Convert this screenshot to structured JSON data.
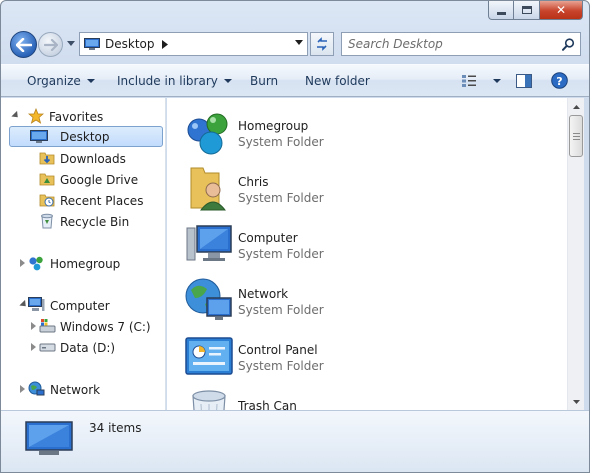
{
  "window": {
    "caption": {
      "minimize": "minimize",
      "maximize": "maximize",
      "close_glyph": "✕"
    }
  },
  "nav": {
    "back_icon": "back-arrow-icon",
    "forward_icon": "forward-arrow-icon",
    "address": {
      "text": "Desktop",
      "icon": "desktop-icon"
    },
    "search": {
      "placeholder": "Search Desktop",
      "value": ""
    }
  },
  "toolbar": {
    "organize": "Organize",
    "include_in_library": "Include in library",
    "burn": "Burn",
    "new_folder": "New folder"
  },
  "navpane": {
    "favorites": {
      "label": "Favorites",
      "items": [
        {
          "label": "Desktop",
          "selected": true
        },
        {
          "label": "Downloads"
        },
        {
          "label": "Google Drive"
        },
        {
          "label": "Recent Places"
        },
        {
          "label": "Recycle Bin"
        }
      ]
    },
    "homegroup": {
      "label": "Homegroup"
    },
    "computer": {
      "label": "Computer",
      "items": [
        {
          "label": "Windows 7 (C:)"
        },
        {
          "label": "Data (D:)"
        }
      ]
    },
    "network": {
      "label": "Network"
    }
  },
  "content": {
    "items": [
      {
        "name": "Homegroup",
        "type": "System Folder",
        "icon": "homegroup-icon"
      },
      {
        "name": "Chris",
        "type": "System Folder",
        "icon": "user-folder-icon"
      },
      {
        "name": "Computer",
        "type": "System Folder",
        "icon": "computer-icon"
      },
      {
        "name": "Network",
        "type": "System Folder",
        "icon": "network-icon"
      },
      {
        "name": "Control Panel",
        "type": "System Folder",
        "icon": "control-panel-icon"
      },
      {
        "name": "Trash Can",
        "type": "",
        "icon": "trash-can-icon"
      }
    ]
  },
  "details": {
    "count": "34 items"
  },
  "colors": {
    "selection": "#c2dcfd",
    "link_text": "#1e395b",
    "secondary_text": "#6d6d6d"
  }
}
